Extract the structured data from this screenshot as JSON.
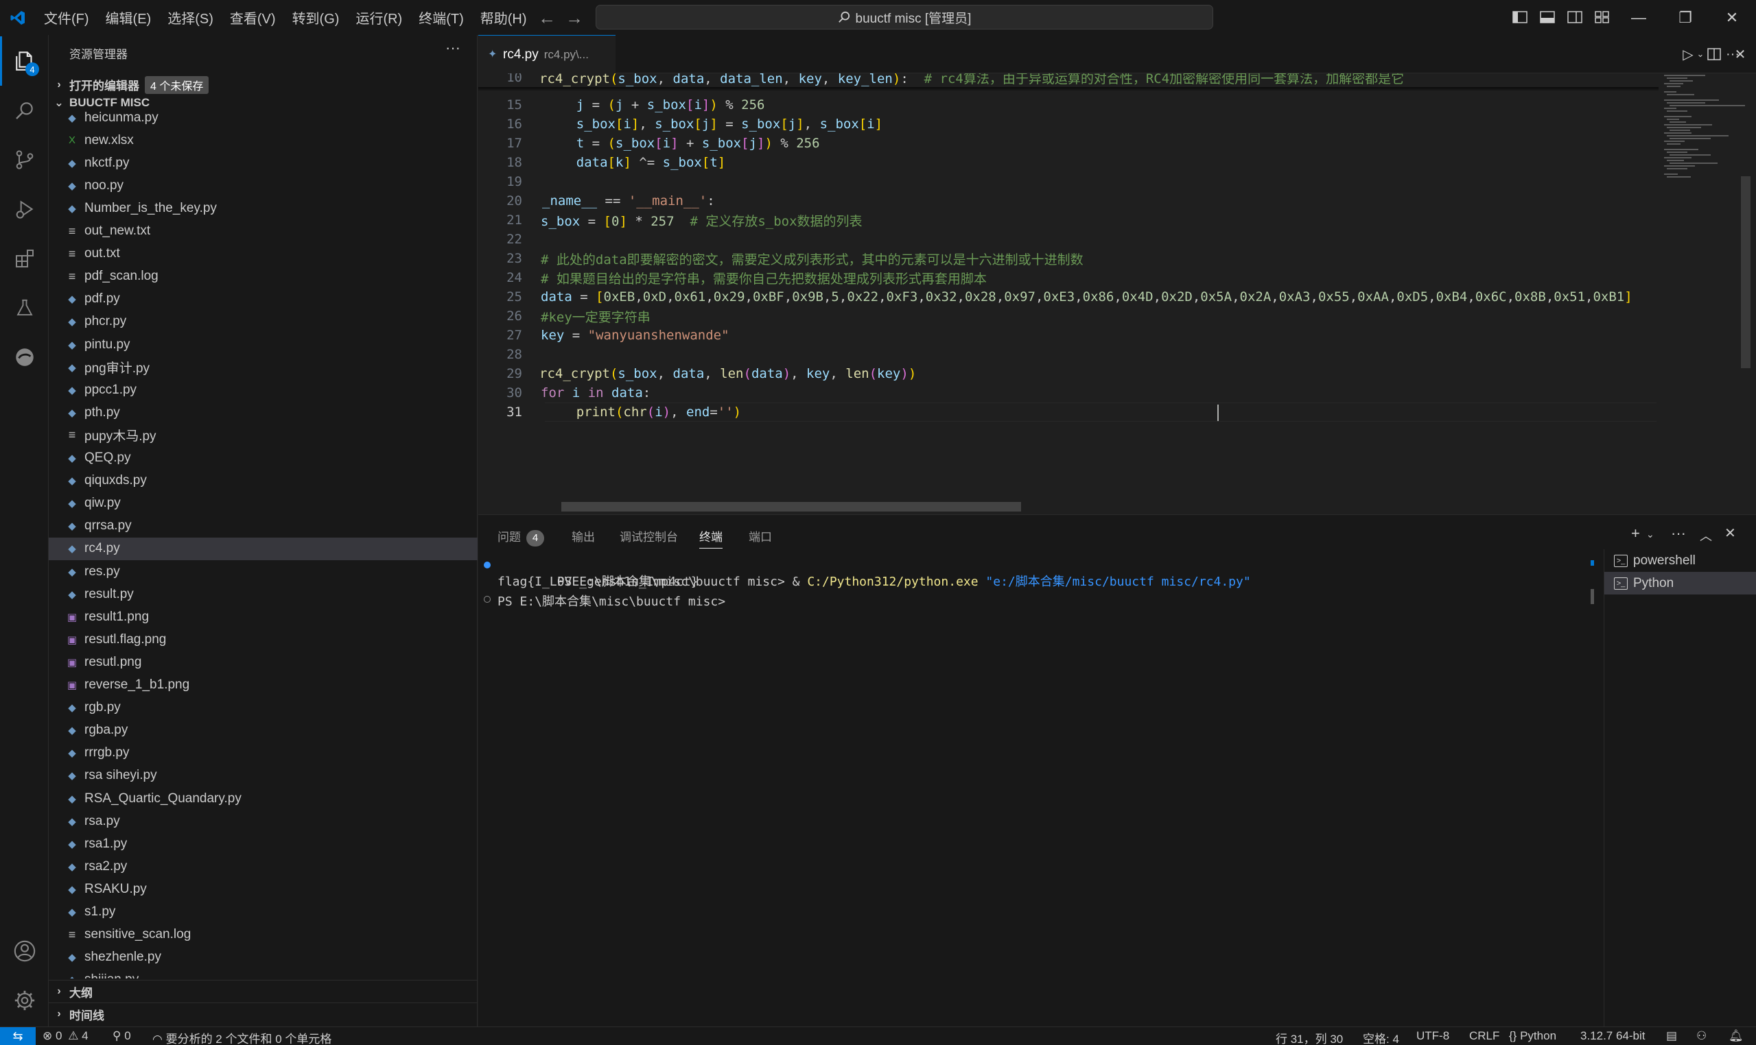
{
  "titlebar": {
    "menus": [
      "文件(F)",
      "编辑(E)",
      "选择(S)",
      "查看(V)",
      "转到(G)",
      "运行(R)",
      "终端(T)",
      "帮助(H)"
    ],
    "search_text": "buuctf misc [管理员]"
  },
  "activity": {
    "explorer_badge": "4"
  },
  "sidebar": {
    "title": "资源管理器",
    "more": "···",
    "open_editors_label": "打开的编辑器",
    "unsaved_badge": "4 个未保存",
    "folder_label": "BUUCTF MISC",
    "outline_label": "大纲",
    "timeline_label": "时间线",
    "files": [
      {
        "name": "heicunma.py",
        "type": "py"
      },
      {
        "name": "new.xlsx",
        "type": "xlsx"
      },
      {
        "name": "nkctf.py",
        "type": "py"
      },
      {
        "name": "noo.py",
        "type": "py"
      },
      {
        "name": "Number_is_the_key.py",
        "type": "py"
      },
      {
        "name": "out_new.txt",
        "type": "txt"
      },
      {
        "name": "out.txt",
        "type": "txt"
      },
      {
        "name": "pdf_scan.log",
        "type": "txt"
      },
      {
        "name": "pdf.py",
        "type": "py"
      },
      {
        "name": "phcr.py",
        "type": "py"
      },
      {
        "name": "pintu.py",
        "type": "py"
      },
      {
        "name": "png审计.py",
        "type": "py"
      },
      {
        "name": "ppcc1.py",
        "type": "py"
      },
      {
        "name": "pth.py",
        "type": "py"
      },
      {
        "name": "pupy木马.py",
        "type": "txt"
      },
      {
        "name": "QEQ.py",
        "type": "py"
      },
      {
        "name": "qiquxds.py",
        "type": "py"
      },
      {
        "name": "qiw.py",
        "type": "py"
      },
      {
        "name": "qrrsa.py",
        "type": "py"
      },
      {
        "name": "rc4.py",
        "type": "py",
        "selected": true
      },
      {
        "name": "res.py",
        "type": "py"
      },
      {
        "name": "result.py",
        "type": "py"
      },
      {
        "name": "result1.png",
        "type": "png"
      },
      {
        "name": "resutl.flag.png",
        "type": "png"
      },
      {
        "name": "resutl.png",
        "type": "png"
      },
      {
        "name": "reverse_1_b1.png",
        "type": "png"
      },
      {
        "name": "rgb.py",
        "type": "py"
      },
      {
        "name": "rgba.py",
        "type": "py"
      },
      {
        "name": "rrrgb.py",
        "type": "py"
      },
      {
        "name": "rsa siheyi.py",
        "type": "py"
      },
      {
        "name": "RSA_Quartic_Quandary.py",
        "type": "py"
      },
      {
        "name": "rsa.py",
        "type": "py"
      },
      {
        "name": "rsa1.py",
        "type": "py"
      },
      {
        "name": "rsa2.py",
        "type": "py"
      },
      {
        "name": "RSAKU.py",
        "type": "py"
      },
      {
        "name": "s1.py",
        "type": "py"
      },
      {
        "name": "sensitive_scan.log",
        "type": "txt"
      },
      {
        "name": "shezhenle.py",
        "type": "py"
      },
      {
        "name": "shijian.py",
        "type": "py"
      }
    ]
  },
  "editor": {
    "tab_name": "rc4.py",
    "tab_desc": "rc4.py\\...",
    "lines": [
      {
        "n": "10",
        "html": "<span class='f'>rc4_crypt</span><span class='b'>(</span><span class='v'>s_box</span>, <span class='v'>data</span>, <span class='v'>data_len</span>, <span class='v'>key</span>, <span class='v'>key_len</span><span class='b'>)</span>:  <span class='c'># rc4算法，由于异或运算的对合性，RC4加密解密使用同一套算法，加解密都是它</span>",
        "indent": "-8"
      },
      {
        "n": "15",
        "html": "    <span class='v'>j</span> = <span class='b'>(</span><span class='v'>j</span> + <span class='v'>s_box</span><span class='bb'>[</span><span class='v'>i</span><span class='bb'>]</span><span class='b'>)</span> % <span class='n'>256</span>"
      },
      {
        "n": "16",
        "html": "    <span class='v'>s_box</span><span class='b'>[</span><span class='v'>i</span><span class='b'>]</span>, <span class='v'>s_box</span><span class='b'>[</span><span class='v'>j</span><span class='b'>]</span> = <span class='v'>s_box</span><span class='b'>[</span><span class='v'>j</span><span class='b'>]</span>, <span class='v'>s_box</span><span class='b'>[</span><span class='v'>i</span><span class='b'>]</span>"
      },
      {
        "n": "17",
        "html": "    <span class='v'>t</span> = <span class='b'>(</span><span class='v'>s_box</span><span class='bb'>[</span><span class='v'>i</span><span class='bb'>]</span> + <span class='v'>s_box</span><span class='bb'>[</span><span class='v'>j</span><span class='bb'>]</span><span class='b'>)</span> % <span class='n'>256</span>"
      },
      {
        "n": "18",
        "html": "    <span class='v'>data</span><span class='b'>[</span><span class='v'>k</span><span class='b'>]</span> ^= <span class='v'>s_box</span><span class='b'>[</span><span class='v'>t</span><span class='b'>]</span>"
      },
      {
        "n": "19",
        "html": ""
      },
      {
        "n": "20",
        "html": "<span class='v'>_name__</span> == <span class='s'>'__main__'</span>:",
        "indent": "-4"
      },
      {
        "n": "21",
        "html": "<span class='v'>s_box</span> = <span class='b'>[</span><span class='n'>0</span><span class='b'>]</span> * <span class='n'>257</span>  <span class='c'># 定义存放s_box数据的列表</span>",
        "indent": "-6"
      },
      {
        "n": "22",
        "html": ""
      },
      {
        "n": "23",
        "html": "<span class='c'># 此处的data即要解密的密文，需要定义成列表形式，其中的元素可以是十六进制或十进制数</span>",
        "indent": "-6"
      },
      {
        "n": "24",
        "html": "<span class='c'># 如果题目给出的是字符串，需要你自己先把数据处理成列表形式再套用脚本</span>",
        "indent": "-6"
      },
      {
        "n": "25",
        "html": "<span class='v'>data</span> = <span class='b'>[</span><span class='n'>0xEB</span>,<span class='n'>0xD</span>,<span class='n'>0x61</span>,<span class='n'>0x29</span>,<span class='n'>0xBF</span>,<span class='n'>0x9B</span>,<span class='n'>5</span>,<span class='n'>0x22</span>,<span class='n'>0xF3</span>,<span class='n'>0x32</span>,<span class='n'>0x28</span>,<span class='n'>0x97</span>,<span class='n'>0xE3</span>,<span class='n'>0x86</span>,<span class='n'>0x4D</span>,<span class='n'>0x2D</span>,<span class='n'>0x5A</span>,<span class='n'>0x2A</span>,<span class='n'>0xA3</span>,<span class='n'>0x55</span>,<span class='n'>0xAA</span>,<span class='n'>0xD5</span>,<span class='n'>0xB4</span>,<span class='n'>0x6C</span>,<span class='n'>0x8B</span>,<span class='n'>0x51</span>,<span class='n'>0xB1</span><span class='b'>]</span>",
        "indent": "-6"
      },
      {
        "n": "26",
        "html": "<span class='c'>#key一定要字符串</span>",
        "indent": "-6"
      },
      {
        "n": "27",
        "html": "<span class='v'>key</span> = <span class='s'>\"wanyuanshenwande\"</span>",
        "indent": "-6"
      },
      {
        "n": "28",
        "html": ""
      },
      {
        "n": "29",
        "html": "<span class='f'>rc4_crypt</span><span class='b'>(</span><span class='v'>s_box</span>, <span class='v'>data</span>, <span class='f'>len</span><span class='bb'>(</span><span class='v'>data</span><span class='bb'>)</span>, <span class='v'>key</span>, <span class='f'>len</span><span class='bb'>(</span><span class='v'>key</span><span class='bb'>)</span><span class='b'>)</span>",
        "indent": "-8"
      },
      {
        "n": "30",
        "html": "<span class='k'>for</span> <span class='v'>i</span> <span class='k'>in</span> <span class='v'>data</span>:",
        "indent": "-6"
      },
      {
        "n": "31",
        "html": "    <span class='f'>print</span><span class='b'>(</span><span class='f'>chr</span><span class='bb'>(</span><span class='v'>i</span><span class='bb'>)</span>, <span class='v'>end</span>=<span class='s'>''</span><span class='b'>)</span>",
        "current": true
      }
    ]
  },
  "panel": {
    "tabs": [
      "问题",
      "输出",
      "调试控制台",
      "终端",
      "端口"
    ],
    "problems_badge": "4",
    "terminal_lines": [
      {
        "prompt": "PS E:\\脚本合集\\misc\\buuctf misc> ",
        "cmd": "& ",
        "exe": "C:/Python312/python.exe",
        "arg": " \"e:/脚本合集/misc/buuctf misc/rc4.py\""
      },
      {
        "text": "flag{I_L0VE_gensh1n_Imp4ct}"
      },
      {
        "text": "PS E:\\脚本合集\\misc\\buuctf misc>"
      }
    ],
    "terminals": [
      "powershell",
      "Python"
    ]
  },
  "statusbar": {
    "errors": "0",
    "warnings": "4",
    "ports": "0",
    "analysis": "要分析的 2 个文件和 0 个单元格",
    "position": "行 31，列 30",
    "spaces": "空格: 4",
    "encoding": "UTF-8",
    "eol": "CRLF",
    "language": "Python",
    "interpreter": "3.12.7 64-bit"
  }
}
